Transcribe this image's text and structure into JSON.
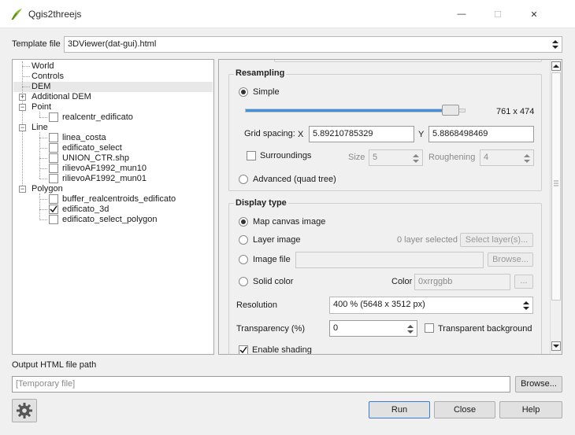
{
  "window": {
    "title": "Qgis2threejs",
    "minimize": "—",
    "maximize": "☐",
    "close": "✕"
  },
  "template": {
    "label": "Template file",
    "value": "3DViewer(dat-gui).html"
  },
  "tree": {
    "items": [
      {
        "label": "World"
      },
      {
        "label": "Controls"
      },
      {
        "label": "DEM"
      },
      {
        "label": "Additional DEM"
      },
      {
        "label": "Point"
      },
      {
        "label": "realcentr_edificato"
      },
      {
        "label": "Line"
      },
      {
        "label": "linea_costa"
      },
      {
        "label": "edificato_select"
      },
      {
        "label": "UNION_CTR.shp"
      },
      {
        "label": "rilievoAF1992_mun10"
      },
      {
        "label": "rilievoAF1992_mun01"
      },
      {
        "label": "Polygon"
      },
      {
        "label": "buffer_realcentroids_edificato"
      },
      {
        "label": "edificato_3d",
        "checked": true
      },
      {
        "label": "edificato_select_polygon"
      }
    ],
    "selected": "DEM"
  },
  "resampling": {
    "title": "Resampling",
    "simple_label": "Simple",
    "slider_value": 0.9,
    "resolution_text": "761 x 474",
    "grid_spacing_label": "Grid spacing:",
    "x_label": "X",
    "x_value": "5.89210785329",
    "y_label": "Y",
    "y_value": "5.8868498469",
    "surroundings_label": "Surroundings",
    "size_label": "Size",
    "size_value": "5",
    "roughening_label": "Roughening",
    "roughening_value": "4",
    "advanced_label": "Advanced (quad tree)"
  },
  "display": {
    "title": "Display type",
    "map_canvas_label": "Map canvas image",
    "layer_image_label": "Layer image",
    "layer_selected_text": "0 layer selected",
    "select_layers_button": "Select layer(s)...",
    "image_file_label": "Image file",
    "browse_button": "Browse...",
    "solid_color_label": "Solid color",
    "color_label": "Color",
    "color_placeholder": "0xrrggbb",
    "color_button": "...",
    "resolution_label": "Resolution",
    "resolution_value": "400 %  (5648 x 3512 px)",
    "transparency_label": "Transparency (%)",
    "transparency_value": "0",
    "transparent_bg_label": "Transparent background",
    "enable_shading_label": "Enable shading"
  },
  "output": {
    "label": "Output HTML file path",
    "placeholder": "[Temporary file]",
    "browse_button": "Browse..."
  },
  "buttons": {
    "run": "Run",
    "close": "Close",
    "help": "Help"
  },
  "colors": {
    "accent": "#3b7bd6",
    "slider_fill": "#3d8fe0"
  }
}
